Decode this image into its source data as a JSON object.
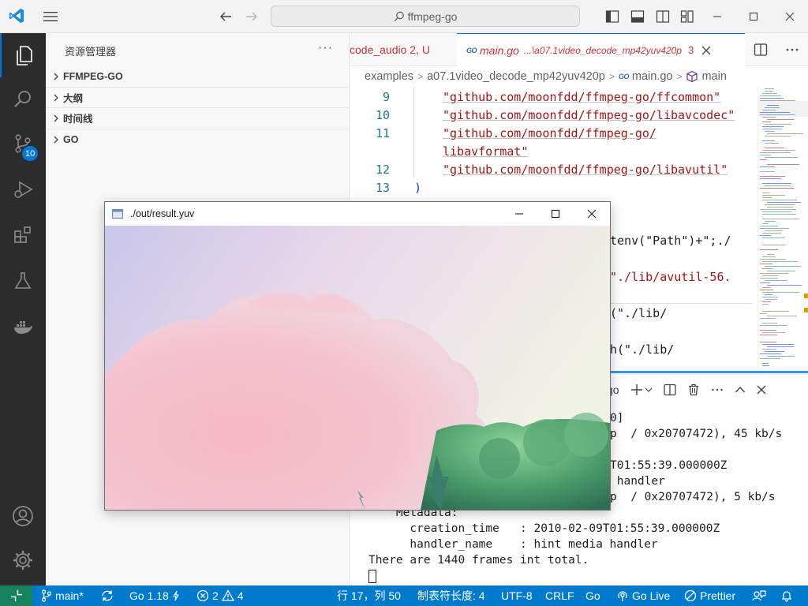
{
  "titlebar": {
    "search_text": "ffmpeg-go"
  },
  "activity": {
    "scm_badge": "10"
  },
  "sidebar": {
    "title": "资源管理器",
    "more": "···",
    "sections": [
      {
        "label": "FFMPEG-GO"
      },
      {
        "label": "大纲"
      },
      {
        "label": "时间线"
      },
      {
        "label": "GO"
      }
    ]
  },
  "tabs": {
    "prev_tab": "code_audio  2, U",
    "active_tab": {
      "icon_text": "GO",
      "name": "main.go",
      "path": "...\\a07.1video_decode_mp42yuv420p",
      "problems": "3"
    }
  },
  "breadcrumbs": {
    "items": [
      "examples",
      "a07.1video_decode_mp42yuv420p",
      "main.go",
      "main"
    ],
    "go_icon_text": "GO"
  },
  "code": {
    "lines": [
      {
        "num": "9",
        "text": "\"github.com/moonfdd/ffmpeg-go/ffcommon\""
      },
      {
        "num": "10",
        "text": "\"github.com/moonfdd/ffmpeg-go/libavcodec\""
      },
      {
        "num": "11",
        "text": "\"github.com/moonfdd/ffmpeg-go/"
      },
      {
        "num": "",
        "text": "libavformat\""
      },
      {
        "num": "12",
        "text": "\"github.com/moonfdd/ffmpeg-go/libavutil\""
      },
      {
        "num": "13",
        "text": ")"
      }
    ],
    "visible_fragments": [
      "tenv(\"Path\")+\";./",
      "\"./lib/avutil-56.",
      "(\"./lib/",
      "h(\"./lib/"
    ]
  },
  "panel": {
    "terminal_name": "go",
    "output_partial": [
      "0]",
      "p  / 0x20707472), 45 kb/s",
      "T01:55:39.000000Z",
      " handler",
      "p  / 0x20707472), 5 kb/s"
    ],
    "output_lines": [
      "    Metadata:",
      "      creation_time   : 2010-02-09T01:55:39.000000Z",
      "      handler_name    : hint media handler",
      "There are 1440 frames int total."
    ]
  },
  "popup": {
    "title": "./out/result.yuv"
  },
  "statusbar": {
    "branch": "main*",
    "go_version": "Go 1.18",
    "errors": "2",
    "warnings": "4",
    "position": "行 17，列 50",
    "tab_size": "制表符长度: 4",
    "encoding": "UTF-8",
    "eol": "CRLF",
    "language": "Go",
    "live": "Go Live",
    "prettier": "Prettier"
  },
  "colors": {
    "accent": "#0078d4",
    "status_bg": "#007acc",
    "remote_bg": "#16825d",
    "activity_bg": "#2c2c2c",
    "string": "#a31515",
    "line_number": "#237893"
  }
}
